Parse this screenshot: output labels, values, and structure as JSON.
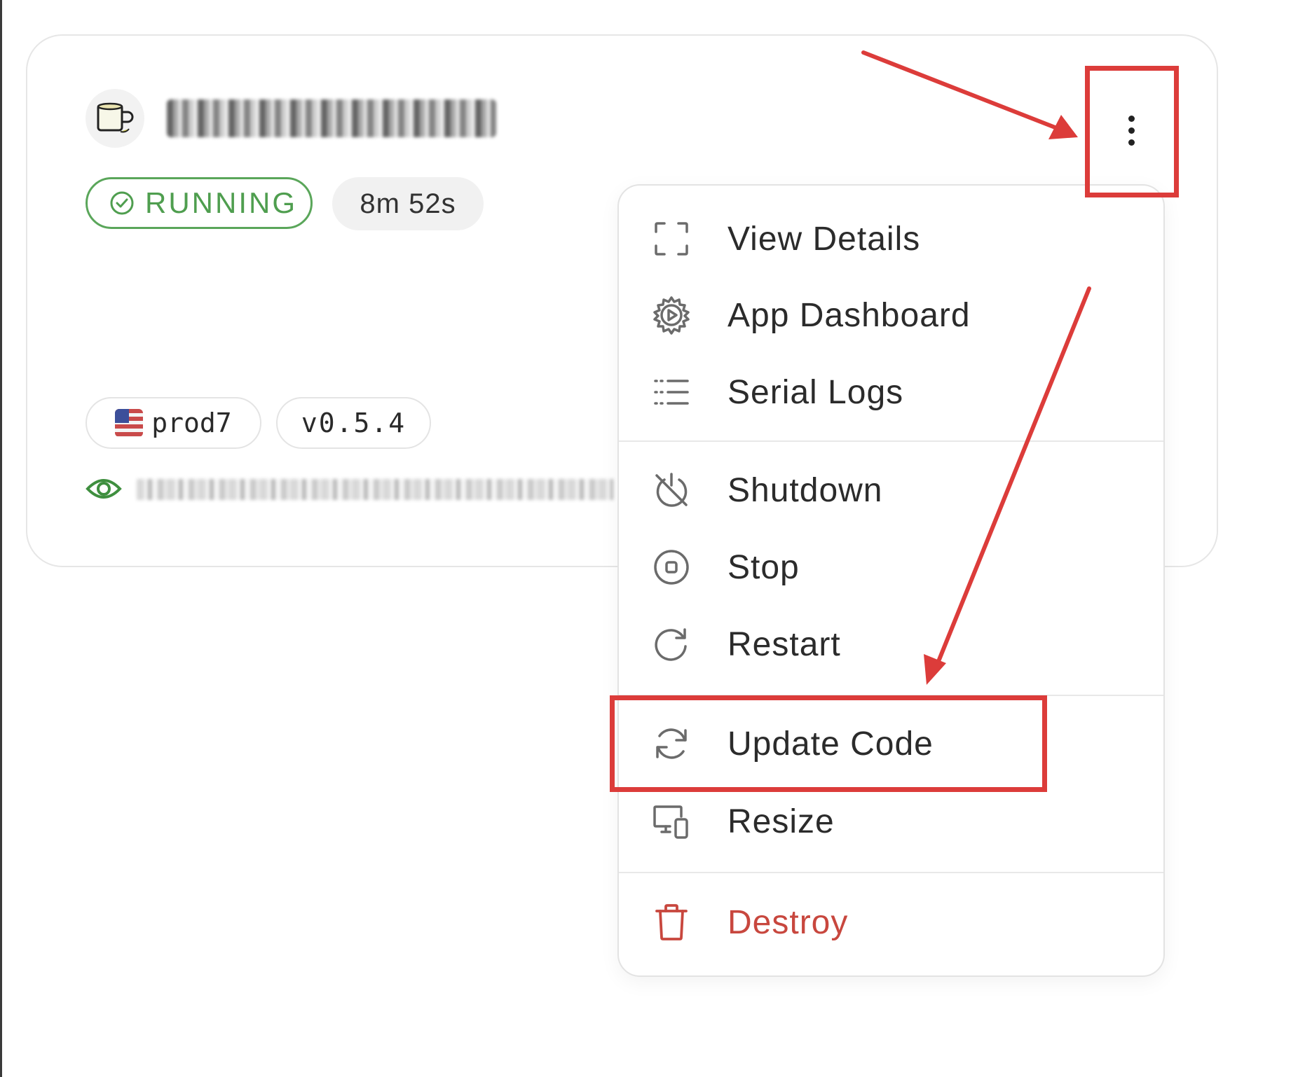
{
  "instance": {
    "status": "RUNNING",
    "uptime": "8m 52s",
    "region_tag": "prod7",
    "version_tag": "v0.5.4"
  },
  "menu": {
    "items": [
      {
        "label": "View Details",
        "icon": "expand-icon"
      },
      {
        "label": "App Dashboard",
        "icon": "gear-play-icon"
      },
      {
        "label": "Serial Logs",
        "icon": "list-icon"
      },
      {
        "label": "Shutdown",
        "icon": "power-off-icon"
      },
      {
        "label": "Stop",
        "icon": "stop-circle-icon"
      },
      {
        "label": "Restart",
        "icon": "restart-icon"
      },
      {
        "label": "Update Code",
        "icon": "sync-icon"
      },
      {
        "label": "Resize",
        "icon": "resize-devices-icon"
      },
      {
        "label": "Destroy",
        "icon": "trash-icon"
      }
    ]
  },
  "colors": {
    "running_green": "#4f9e4f",
    "danger_red": "#c8473e",
    "annotation_red": "#dc3c3a"
  }
}
